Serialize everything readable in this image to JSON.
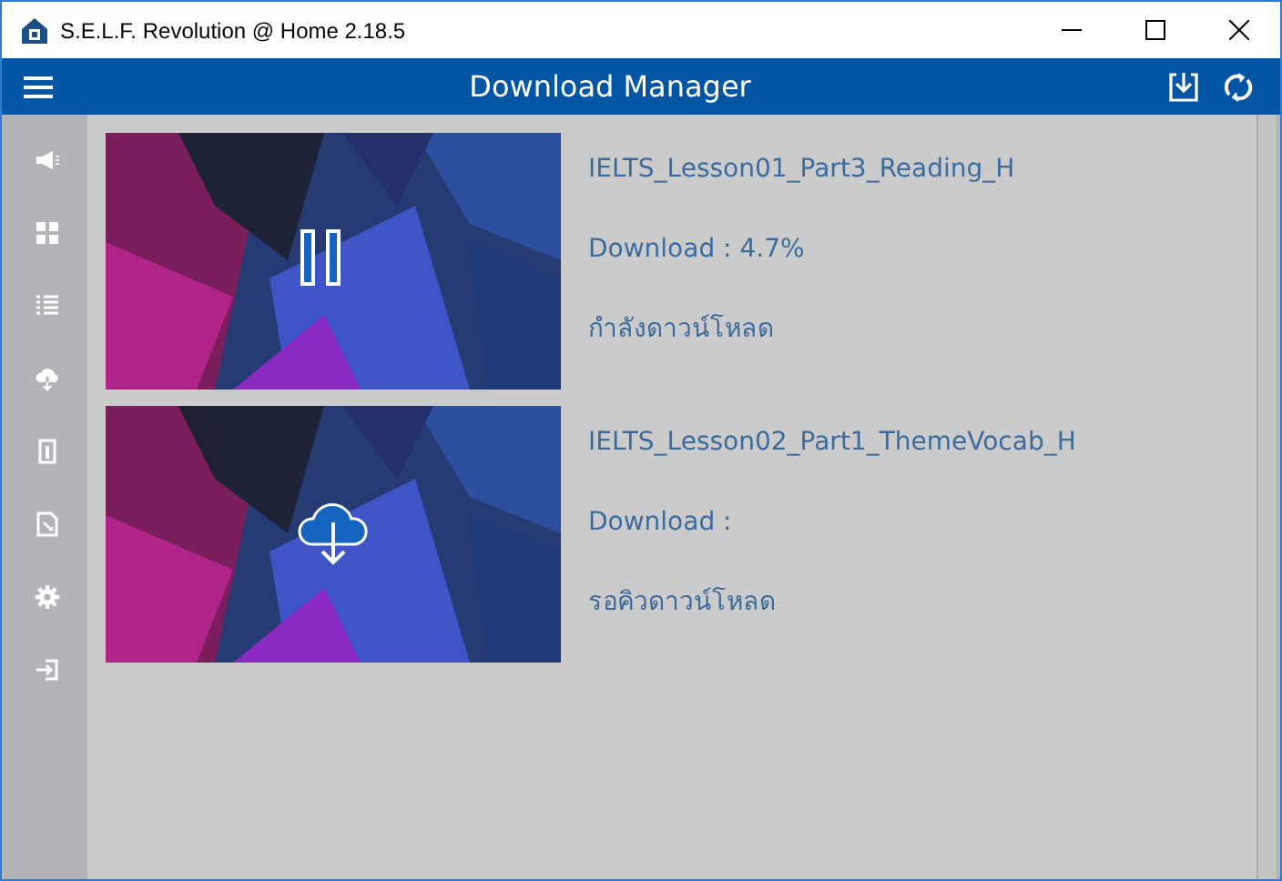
{
  "window": {
    "title": "S.E.L.F. Revolution @ Home 2.18.5"
  },
  "header": {
    "title": "Download Manager"
  },
  "downloads": [
    {
      "kind": "downloading",
      "name": "IELTS_Lesson01_Part3_Reading_H",
      "progress": "Download : 4.7%",
      "status": "กำลังดาวน์โหลด"
    },
    {
      "kind": "queued",
      "name": "IELTS_Lesson02_Part1_ThemeVocab_H",
      "progress": "Download :",
      "status": "รอคิวดาวน์โหลด"
    }
  ]
}
